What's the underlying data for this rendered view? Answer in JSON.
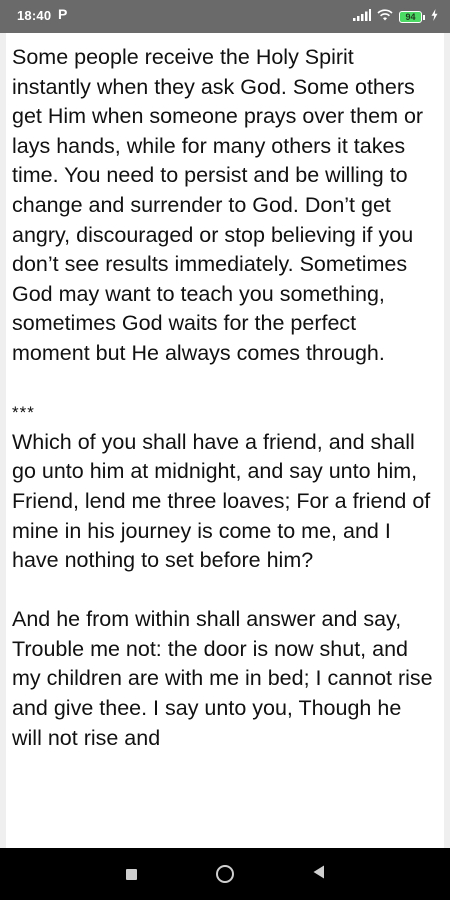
{
  "status_bar": {
    "time": "18:40",
    "notification_letter": "P",
    "battery_level": "94",
    "icons": [
      "signal-icon",
      "wifi-icon",
      "battery-icon",
      "charging-icon"
    ]
  },
  "content": {
    "paragraphs": [
      "Some people receive the Holy Spirit instantly when they ask God. Some others get Him when someone prays over them or lays hands, while for many others it takes time. You need to persist and be willing to change and surrender to God. Don’t get angry, discouraged or stop believing if you don’t see results immediately. Sometimes God may want to teach you something, sometimes God waits for the perfect moment but He always comes through.",
      "***",
      "Which of you shall have a friend, and shall go unto him at midnight, and say unto him, Friend, lend me three loaves; For a friend of mine in his journey is come to me, and I have nothing to set before him?",
      "And he from within shall answer and say, Trouble me not: the door is now shut, and my children are with me in bed; I cannot rise and give thee. I say unto you, Though he will not rise and"
    ]
  },
  "nav_bar": {
    "buttons": [
      "recents-button",
      "home-button",
      "back-button"
    ]
  },
  "colors": {
    "status_bar_bg": "#6a6a6a",
    "battery_green": "#4cd964",
    "nav_bar_bg": "#000000",
    "text": "#111111"
  }
}
